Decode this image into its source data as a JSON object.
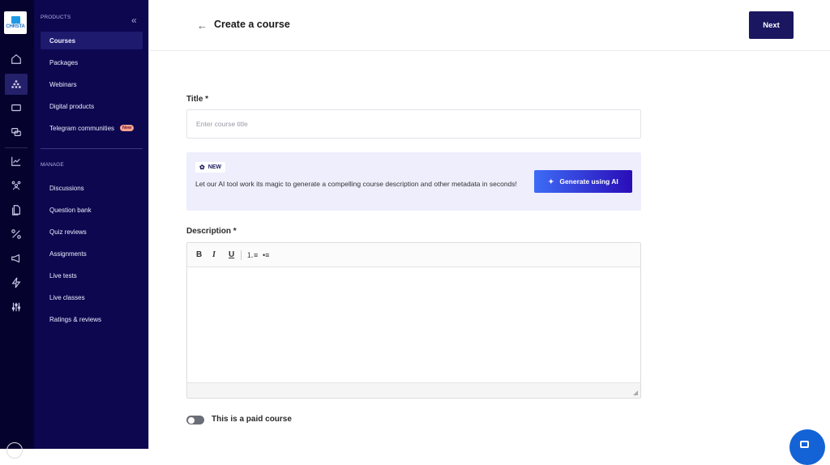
{
  "brand": {
    "logo_text": "CHRSTA"
  },
  "rail": {
    "icons": [
      "home-icon",
      "products-icon",
      "ticket-icon",
      "chat-icon",
      "analytics-icon",
      "users-icon",
      "documents-icon",
      "tools-icon",
      "megaphone-icon",
      "lightning-icon",
      "settings-sliders-icon"
    ]
  },
  "sidebar": {
    "products_label": "PRODUCTS",
    "manage_label": "MANAGE",
    "products": [
      {
        "label": "Courses",
        "active": true
      },
      {
        "label": "Packages"
      },
      {
        "label": "Webinars"
      },
      {
        "label": "Digital products"
      },
      {
        "label": "Telegram communities",
        "badge": "New"
      }
    ],
    "manage": [
      {
        "label": "Discussions"
      },
      {
        "label": "Question bank"
      },
      {
        "label": "Quiz reviews"
      },
      {
        "label": "Assignments"
      },
      {
        "label": "Live tests"
      },
      {
        "label": "Live classes"
      },
      {
        "label": "Ratings & reviews"
      }
    ]
  },
  "header": {
    "title": "Create a course",
    "next_label": "Next"
  },
  "form": {
    "title_label": "Title *",
    "title_placeholder": "Enter course title",
    "title_value": "",
    "ai": {
      "chip": "NEW",
      "text": "Let our AI tool work its magic to generate a compelling course description and other metadata in seconds!",
      "button": "Generate using AI"
    },
    "description_label": "Description *",
    "toolbar": {
      "bold": "B",
      "italic": "I",
      "underline": "U"
    },
    "paid_toggle_label": "This is a paid course",
    "paid": false
  },
  "colors": {
    "accent": "#1a1660",
    "sidebar": "#0c074f",
    "rail": "#05032e"
  }
}
